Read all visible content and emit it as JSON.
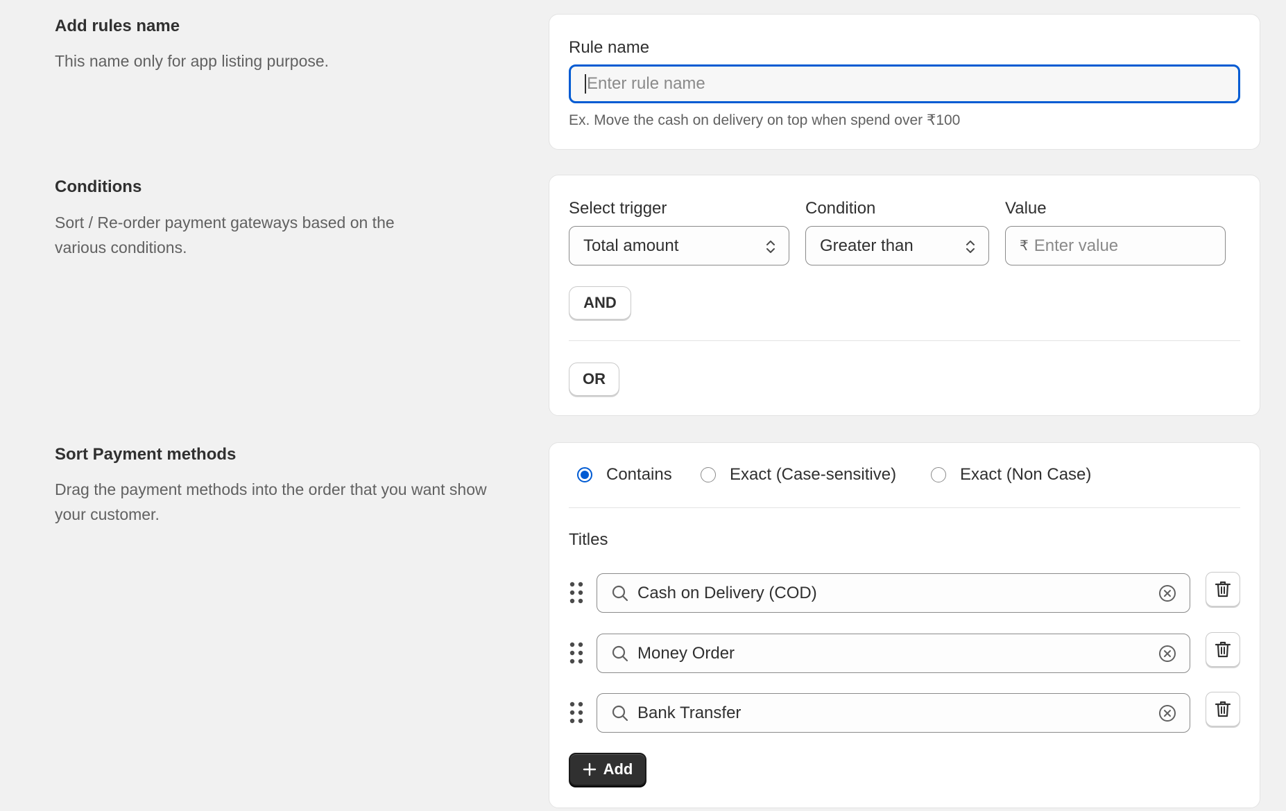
{
  "rule_section": {
    "heading": "Add rules name",
    "description": "This name only for app listing purpose.",
    "field_label": "Rule name",
    "placeholder": "Enter rule name",
    "help": "Ex. Move the cash on delivery on top when spend over ₹100"
  },
  "conditions_section": {
    "heading": "Conditions",
    "description_line1": "Sort / Re-order payment gateways based on the",
    "description_line2": "various conditions.",
    "trigger_label": "Select trigger",
    "trigger_value": "Total amount",
    "condition_label": "Condition",
    "condition_value": "Greater than",
    "value_label": "Value",
    "value_prefix": "₹",
    "value_placeholder": "Enter value",
    "and_label": "AND",
    "or_label": "OR"
  },
  "sort_section": {
    "heading": "Sort Payment methods",
    "description_line1": "Drag the payment methods into the order that you want show",
    "description_line2": "your customer.",
    "match_options": [
      {
        "label": "Contains",
        "checked": true
      },
      {
        "label": "Exact (Case-sensitive)",
        "checked": false
      },
      {
        "label": "Exact (Non Case)",
        "checked": false
      }
    ],
    "titles_label": "Titles",
    "titles": [
      "Cash on Delivery (COD)",
      "Money Order",
      "Bank Transfer"
    ],
    "add_label": "Add"
  },
  "colors": {
    "background": "#f1f1f1",
    "card": "#ffffff",
    "focus_ring": "#005bd3",
    "primary_button": "#303030"
  },
  "icons": [
    "drag-handle-icon",
    "search-icon",
    "clear-icon",
    "trash-icon",
    "plus-icon",
    "chevron-updown-icon"
  ]
}
